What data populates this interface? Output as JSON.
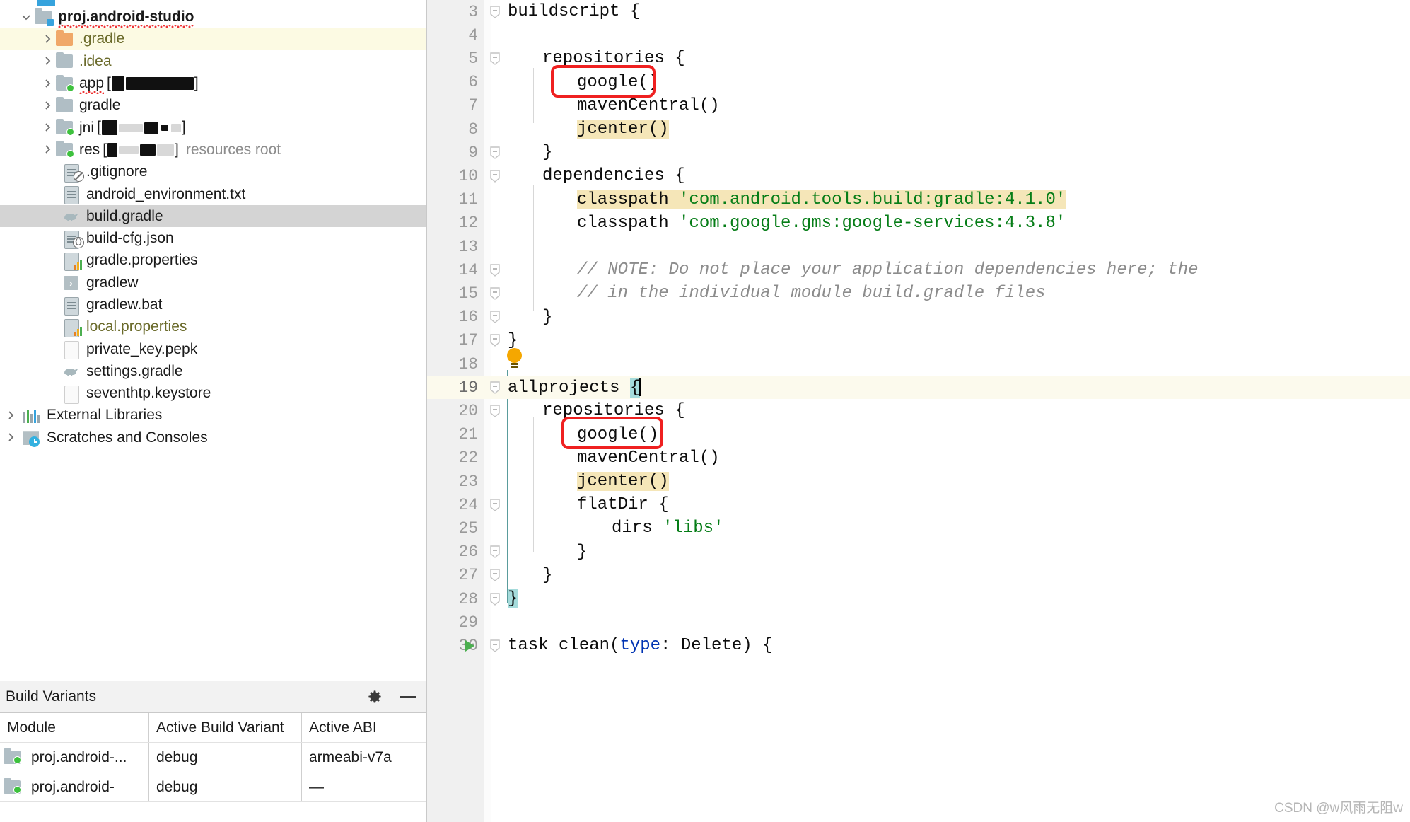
{
  "project_tree": {
    "root": {
      "label": "proj.android-studio",
      "expanded": true,
      "misspelled": true
    },
    "items": [
      {
        "label": ".gradle",
        "icon": "folder-orange-icon",
        "expandable": true,
        "highlight": "yellow",
        "text_color": "olive",
        "indent": 1
      },
      {
        "label": ".idea",
        "icon": "folder-icon",
        "expandable": true,
        "text_color": "olive",
        "indent": 1
      },
      {
        "label": "app",
        "suffix_redacted": true,
        "icon": "folder-module-icon",
        "expandable": true,
        "indent": 1,
        "misspelled": true
      },
      {
        "label": "gradle",
        "icon": "folder-icon",
        "expandable": true,
        "indent": 1
      },
      {
        "label": "jni",
        "suffix_redacted": true,
        "icon": "folder-module-icon",
        "expandable": true,
        "indent": 1
      },
      {
        "label": "res",
        "suffix_redacted": true,
        "trailing": "resources root",
        "icon": "folder-module-icon",
        "expandable": true,
        "indent": 1
      },
      {
        "label": ".gitignore",
        "icon": "file-ignored-icon",
        "indent": 2
      },
      {
        "label": "android_environment.txt",
        "icon": "file-text-icon",
        "indent": 2
      },
      {
        "label": "build.gradle",
        "icon": "gradle-file-icon",
        "indent": 2,
        "highlight": "grey",
        "selected": true
      },
      {
        "label": "build-cfg.json",
        "icon": "file-json-icon",
        "indent": 2
      },
      {
        "label": "gradle.properties",
        "icon": "file-properties-icon",
        "indent": 2
      },
      {
        "label": "gradlew",
        "icon": "shell-script-icon",
        "indent": 2
      },
      {
        "label": "gradlew.bat",
        "icon": "file-text-icon",
        "indent": 2
      },
      {
        "label": "local.properties",
        "icon": "file-properties-icon",
        "indent": 2,
        "text_color": "olive"
      },
      {
        "label": "private_key.pepk",
        "icon": "file-plain-icon",
        "indent": 2
      },
      {
        "label": "settings.gradle",
        "icon": "gradle-file-icon",
        "indent": 2
      },
      {
        "label": "seventhtp.keystore",
        "icon": "file-plain-icon",
        "indent": 2
      },
      {
        "label": "External Libraries",
        "icon": "external-libraries-icon",
        "expandable": true,
        "indent": 0
      },
      {
        "label": "Scratches and Consoles",
        "icon": "scratches-icon",
        "expandable": true,
        "indent": 0
      }
    ]
  },
  "build_variants": {
    "title": "Build Variants",
    "settings_icon": "gear-icon",
    "minimize_icon": "minimize-icon",
    "columns": [
      "Module",
      "Active Build Variant",
      "Active ABI"
    ],
    "rows": [
      {
        "module": "proj.android-...",
        "variant": "debug",
        "abi": "armeabi-v7a"
      },
      {
        "module": "proj.android-",
        "variant": "debug",
        "abi": "—"
      }
    ]
  },
  "editor": {
    "current_line": 19,
    "lines": [
      {
        "n": 3,
        "fold": "minus",
        "indent": 0,
        "tokens": [
          {
            "t": "buildscript {",
            "c": "k"
          }
        ]
      },
      {
        "n": 4,
        "fold": "",
        "indent": 0,
        "tokens": []
      },
      {
        "n": 5,
        "fold": "minus",
        "indent": 1,
        "tokens": [
          {
            "t": "repositories {",
            "c": "k"
          }
        ]
      },
      {
        "n": 6,
        "fold": "",
        "indent": 2,
        "tokens": [
          {
            "t": "google()",
            "c": "k",
            "boxed": true
          }
        ]
      },
      {
        "n": 7,
        "fold": "",
        "indent": 2,
        "tokens": [
          {
            "t": "mavenCentral()",
            "c": "k"
          }
        ]
      },
      {
        "n": 8,
        "fold": "",
        "indent": 2,
        "tokens": [
          {
            "t": "jcenter()",
            "c": "k",
            "hl": "yellow"
          }
        ]
      },
      {
        "n": 9,
        "fold": "minus",
        "indent": 1,
        "tokens": [
          {
            "t": "}",
            "c": "k"
          }
        ]
      },
      {
        "n": 10,
        "fold": "minus",
        "indent": 1,
        "tokens": [
          {
            "t": "dependencies {",
            "c": "k"
          }
        ]
      },
      {
        "n": 11,
        "fold": "",
        "indent": 2,
        "hl": "yellow",
        "tokens": [
          {
            "t": "classpath ",
            "c": "k"
          },
          {
            "t": "'com.android.tools.build:gradle:4.1.0'",
            "c": "str"
          }
        ]
      },
      {
        "n": 12,
        "fold": "",
        "indent": 2,
        "tokens": [
          {
            "t": "classpath ",
            "c": "k"
          },
          {
            "t": "'com.google.gms:google-services:4.3.8'",
            "c": "str"
          }
        ]
      },
      {
        "n": 13,
        "fold": "",
        "indent": 0,
        "tokens": []
      },
      {
        "n": 14,
        "fold": "minus",
        "indent": 2,
        "tokens": [
          {
            "t": "// NOTE: Do not place your application dependencies here; the",
            "c": "cmt"
          }
        ]
      },
      {
        "n": 15,
        "fold": "minus",
        "indent": 2,
        "tokens": [
          {
            "t": "// in the individual module build.gradle files",
            "c": "cmt"
          }
        ]
      },
      {
        "n": 16,
        "fold": "minus",
        "indent": 1,
        "tokens": [
          {
            "t": "}",
            "c": "k"
          }
        ]
      },
      {
        "n": 17,
        "fold": "minus",
        "indent": 0,
        "tokens": [
          {
            "t": "}",
            "c": "k"
          }
        ]
      },
      {
        "n": 18,
        "fold": "",
        "indent": 0,
        "bulb": true,
        "tokens": []
      },
      {
        "n": 19,
        "fold": "minus",
        "indent": 0,
        "current": true,
        "tokens": [
          {
            "t": "allprojects ",
            "c": "k"
          },
          {
            "t": "{",
            "c": "k",
            "sel": true
          },
          {
            "t": "",
            "c": "caret"
          }
        ]
      },
      {
        "n": 20,
        "fold": "minus",
        "indent": 1,
        "tokens": [
          {
            "t": "repositories {",
            "c": "k"
          }
        ]
      },
      {
        "n": 21,
        "fold": "",
        "indent": 2,
        "tokens": [
          {
            "t": "google()",
            "c": "k",
            "boxed": true
          }
        ]
      },
      {
        "n": 22,
        "fold": "",
        "indent": 2,
        "tokens": [
          {
            "t": "mavenCentral()",
            "c": "k"
          }
        ]
      },
      {
        "n": 23,
        "fold": "",
        "indent": 2,
        "tokens": [
          {
            "t": "jcenter()",
            "c": "k",
            "hl": "yellow"
          }
        ]
      },
      {
        "n": 24,
        "fold": "minus",
        "indent": 2,
        "tokens": [
          {
            "t": "flatDir {",
            "c": "k"
          }
        ]
      },
      {
        "n": 25,
        "fold": "",
        "indent": 3,
        "tokens": [
          {
            "t": "dirs ",
            "c": "k"
          },
          {
            "t": "'libs'",
            "c": "str"
          }
        ]
      },
      {
        "n": 26,
        "fold": "minus",
        "indent": 2,
        "tokens": [
          {
            "t": "}",
            "c": "k"
          }
        ]
      },
      {
        "n": 27,
        "fold": "minus",
        "indent": 1,
        "tokens": [
          {
            "t": "}",
            "c": "k"
          }
        ]
      },
      {
        "n": 28,
        "fold": "minus",
        "indent": 0,
        "tokens": [
          {
            "t": "}",
            "c": "k",
            "sel": true
          }
        ]
      },
      {
        "n": 29,
        "fold": "",
        "indent": 0,
        "tokens": []
      },
      {
        "n": 30,
        "fold": "minus",
        "indent": 0,
        "run": true,
        "tokens": [
          {
            "t": "task clean(",
            "c": "k"
          },
          {
            "t": "type",
            "c": "kw"
          },
          {
            "t": ": Delete) {",
            "c": "k"
          }
        ]
      }
    ]
  },
  "watermark": "CSDN @w风雨无阻w",
  "colors": {
    "highlight_yellow": "#f5e6b8",
    "current_line": "#fcfaed",
    "selection_teal": "#a5dbdb",
    "annotation_red": "#ef2020",
    "string_green": "#067d17",
    "comment_grey": "#8c8c8c",
    "tree_selection_grey": "#d4d4d4",
    "tree_highlight_yellow": "#fcfae3"
  }
}
